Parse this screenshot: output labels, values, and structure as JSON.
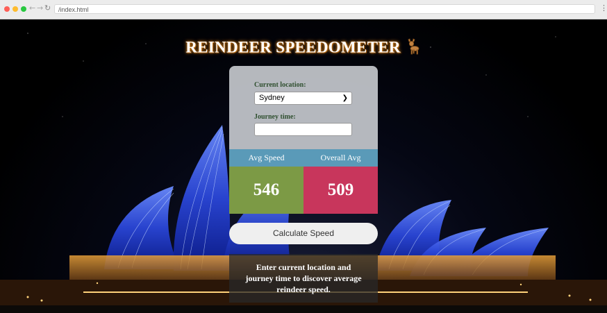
{
  "browser": {
    "address": "/index.html",
    "back_icon": "arrow-left-icon",
    "forward_icon": "arrow-right-icon",
    "reload_icon": "reload-icon",
    "menu_icon": "kebab-menu-icon"
  },
  "app": {
    "title": "REINDEER SPEEDOMETER",
    "title_icon": "reindeer-icon"
  },
  "form": {
    "location_label": "Current location:",
    "location_value": "Sydney",
    "journey_label": "Journey time:",
    "journey_value": ""
  },
  "stats": {
    "avg_label": "Avg Speed",
    "overall_label": "Overall Avg",
    "avg_value": "546",
    "overall_value": "509"
  },
  "button": {
    "calculate_label": "Calculate Speed"
  },
  "message": "Enter current location and journey time to discover average reindeer speed.",
  "colors": {
    "avg_bg": "#7c9a45",
    "overall_bg": "#c8365c",
    "header_bg": "#5a9ab8",
    "card_bg": "#c3c6cb"
  }
}
